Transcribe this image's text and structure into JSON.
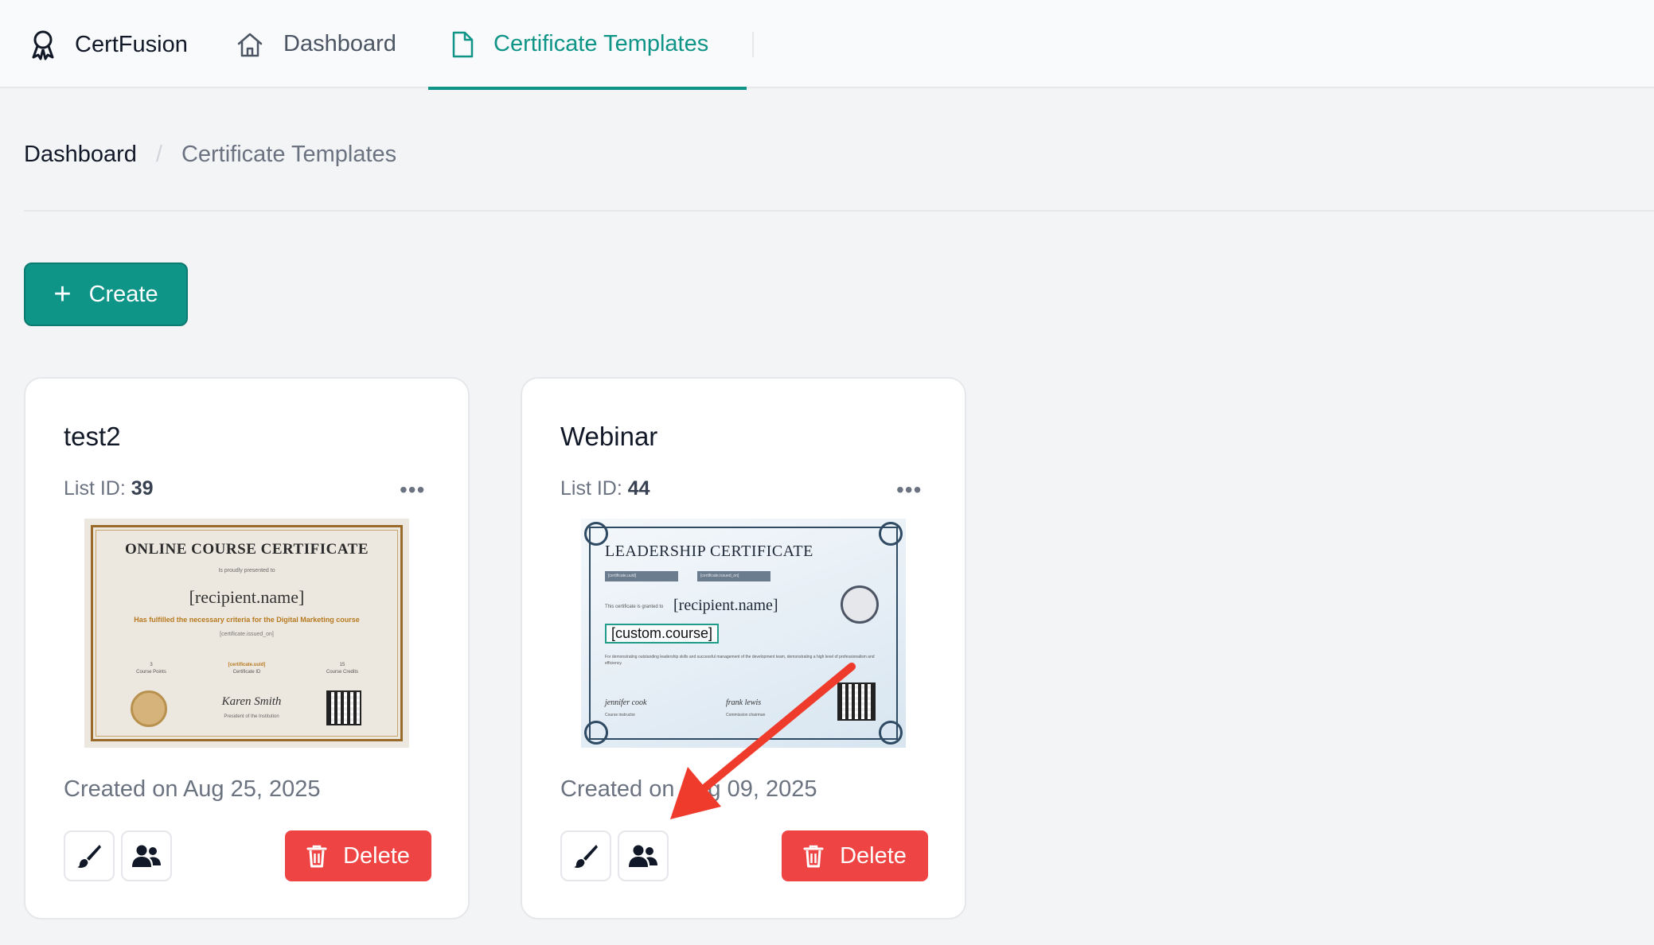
{
  "nav": {
    "brand": "CertFusion",
    "tabs": [
      {
        "label": "Dashboard",
        "icon": "home-icon"
      },
      {
        "label": "Certificate Templates",
        "icon": "file-icon",
        "active": true
      }
    ],
    "accent_color": "#0f9488"
  },
  "breadcrumb": {
    "home": "Dashboard",
    "separator": "/",
    "current": "Certificate Templates"
  },
  "create_button": {
    "label": "Create",
    "icon": "plus-icon"
  },
  "list_id_label": "List ID:",
  "templates": [
    {
      "title": "test2",
      "list_id": "39",
      "more": "•••",
      "created": "Created on Aug 25, 2025",
      "delete_label": "Delete",
      "preview": {
        "heading": "ONLINE COURSE CERTIFICATE",
        "presented": "Is proudly presented to",
        "recipient": "[recipient.name]",
        "fulfilled": "Has fulfilled the necessary criteria for the Digital Marketing course",
        "issued": "[certificate.issued_on]",
        "points_value": "3",
        "points_label": "Course Points",
        "id_value": "[certificate.uuid]",
        "id_label": "Certificate ID",
        "credits_value": "15",
        "credits_label": "Course Credits",
        "signature": "Karen Smith",
        "signer_title": "President of the Institution"
      }
    },
    {
      "title": "Webinar",
      "list_id": "44",
      "more": "•••",
      "created": "Created on Aug 09, 2025",
      "delete_label": "Delete",
      "preview": {
        "heading": "LEADERSHIP CERTIFICATE",
        "uuid_tag": "[certificate.uuid]",
        "issued_tag": "[certificate.issued_on]",
        "granted": "This certificate is granted to",
        "recipient": "[recipient.name]",
        "course": "[custom.course]",
        "body": "For demonstrating outstanding leadership skills and successful management of the development team, demonstrating a high level of professionalism and efficiency.",
        "sign1": "jennifer cook",
        "role1": "Course instructor",
        "sign2": "frank lewis",
        "role2": "Commission chairman"
      }
    }
  ],
  "annotation_color": "#ef3b2c"
}
